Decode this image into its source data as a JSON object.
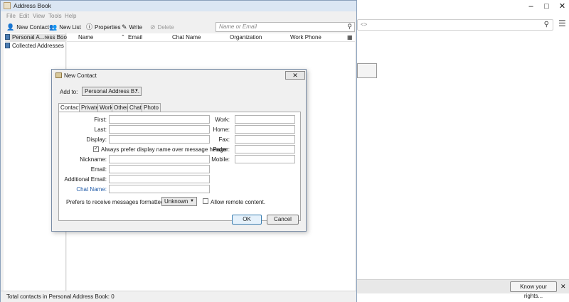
{
  "background": {
    "url_placeholder": "<>",
    "know_rights_label": "Know your rights...",
    "close_label": "✕",
    "window_controls": [
      "–",
      "□",
      "✕"
    ]
  },
  "window": {
    "title": "Address Book",
    "menu": [
      "File",
      "Edit",
      "View",
      "Tools",
      "Help"
    ],
    "toolbar": {
      "new_contact": "New Contact",
      "new_list": "New List",
      "properties": "Properties",
      "write": "Write",
      "delete": "Delete"
    },
    "search_placeholder": "Name or Email",
    "sidebar": [
      "Personal A...ress Book",
      "Collected Addresses"
    ],
    "columns": [
      "Name",
      "Email",
      "Chat Name",
      "Organization",
      "Work Phone"
    ],
    "status": "Total contacts in Personal Address Book: 0"
  },
  "dialog": {
    "title": "New Contact",
    "close_label": "✕",
    "add_to_label": "Add to:",
    "add_to_value": "Personal Address B...",
    "tabs": [
      "Contact",
      "Private",
      "Work",
      "Other",
      "Chat",
      "Photo"
    ],
    "fields": {
      "first": "First:",
      "last": "Last:",
      "display": "Display:",
      "prefer_display": "Always prefer display name over message header",
      "nickname": "Nickname:",
      "email": "Email:",
      "additional_email": "Additional Email:",
      "chat_name": "Chat Name:",
      "work": "Work:",
      "home": "Home:",
      "fax": "Fax:",
      "pager": "Pager:",
      "mobile": "Mobile:"
    },
    "prefers_label": "Prefers to receive messages formatted as:",
    "format_value": "Unknown",
    "allow_remote_label": "Allow remote content.",
    "ok_label": "OK",
    "cancel_label": "Cancel"
  }
}
